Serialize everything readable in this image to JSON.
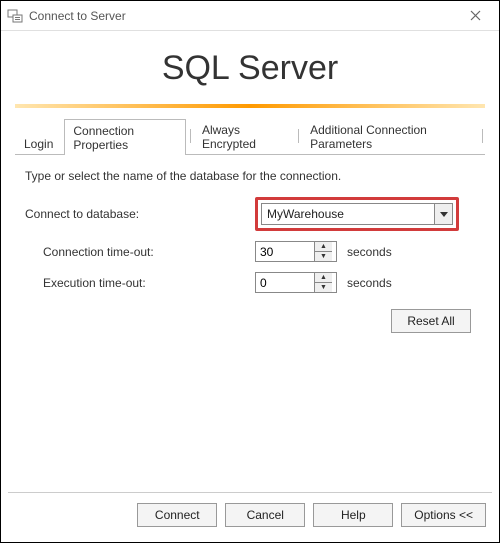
{
  "window": {
    "title": "Connect to Server"
  },
  "header": {
    "product": "SQL Server"
  },
  "tabs": {
    "items": [
      {
        "label": "Login"
      },
      {
        "label": "Connection Properties"
      },
      {
        "label": "Always Encrypted"
      },
      {
        "label": "Additional Connection Parameters"
      }
    ],
    "active_index": 1
  },
  "panel": {
    "instruction": "Type or select the name of the database for the connection.",
    "database_label": "Connect to database:",
    "database_value": "MyWarehouse",
    "conn_timeout_label": "Connection time-out:",
    "conn_timeout_value": "30",
    "exec_timeout_label": "Execution time-out:",
    "exec_timeout_value": "0",
    "seconds_unit": "seconds",
    "reset_label": "Reset All"
  },
  "footer": {
    "connect": "Connect",
    "cancel": "Cancel",
    "help": "Help",
    "options": "Options <<"
  },
  "colors": {
    "highlight_box": "#d23b3b",
    "accent_gradient_mid": "#ff9a00"
  }
}
